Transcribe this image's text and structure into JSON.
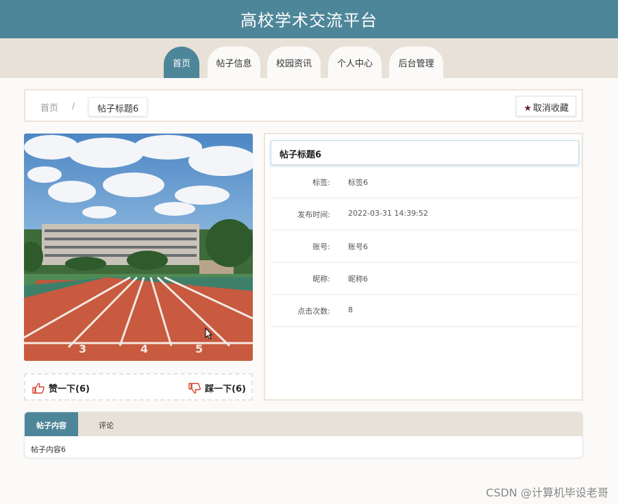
{
  "header": {
    "title": "高校学术交流平台"
  },
  "nav": {
    "items": [
      "首页",
      "帖子信息",
      "校园资讯",
      "个人中心",
      "后台管理"
    ]
  },
  "breadcrumb": {
    "home": "首页",
    "separator": "/",
    "current": "帖子标题6"
  },
  "favorite_button": {
    "label": "取消收藏",
    "icon": "star-icon"
  },
  "votes": {
    "up": "赞一下(6)",
    "down": "踩一下(6)"
  },
  "detail": {
    "title": "帖子标题6",
    "rows": [
      {
        "label": "标签:",
        "value": "标签6"
      },
      {
        "label": "发布时间:",
        "value": "2022-03-31 14:39:52"
      },
      {
        "label": "账号:",
        "value": "账号6"
      },
      {
        "label": "昵称:",
        "value": "昵称6"
      },
      {
        "label": "点击次数:",
        "value": "8"
      }
    ]
  },
  "tabs": {
    "items": [
      "帖子内容",
      "评论"
    ],
    "active": "帖子内容",
    "content": "帖子内容6"
  },
  "watermark": "CSDN @计算机毕设老哥",
  "colors": {
    "primary": "#4e8699",
    "beige": "#e8e1d7",
    "accent": "#6b1d2f",
    "thumb": "#d9412a"
  }
}
